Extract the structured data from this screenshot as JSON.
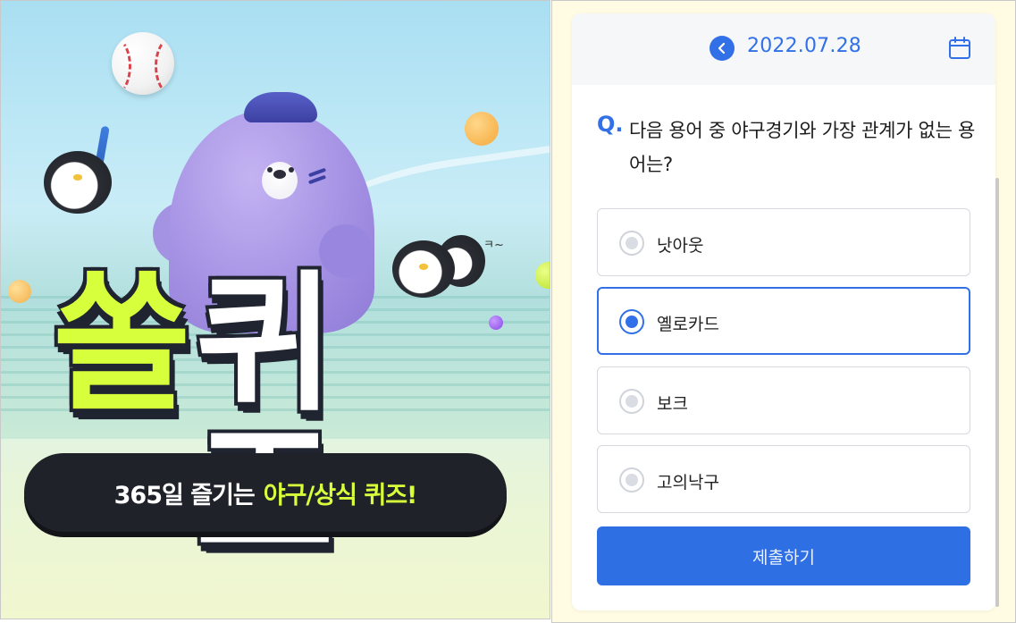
{
  "banner": {
    "title_part1": "쏠",
    "title_part2": "퀴즈",
    "subtitle": "365일 즐기는",
    "subtitle_highlight": "야구/상식 퀴즈!",
    "squiggle": "ㅋ~",
    "colors": {
      "accent": "#d8ff3c",
      "pill": "#1f2329"
    }
  },
  "quiz": {
    "date": "2022.07.28",
    "prev_icon": "chevron-left-icon",
    "calendar_icon": "calendar-icon",
    "question_mark": "Q.",
    "question": "다음 용어 중 야구경기와 가장 관계가 없는 용어는?",
    "options": [
      {
        "label": "낫아웃",
        "selected": false
      },
      {
        "label": "옐로카드",
        "selected": true
      },
      {
        "label": "보크",
        "selected": false
      },
      {
        "label": "고의낙구",
        "selected": false
      }
    ],
    "submit_label": "제출하기",
    "colors": {
      "primary": "#3170e6",
      "panel_bg": "#fffce3"
    }
  }
}
